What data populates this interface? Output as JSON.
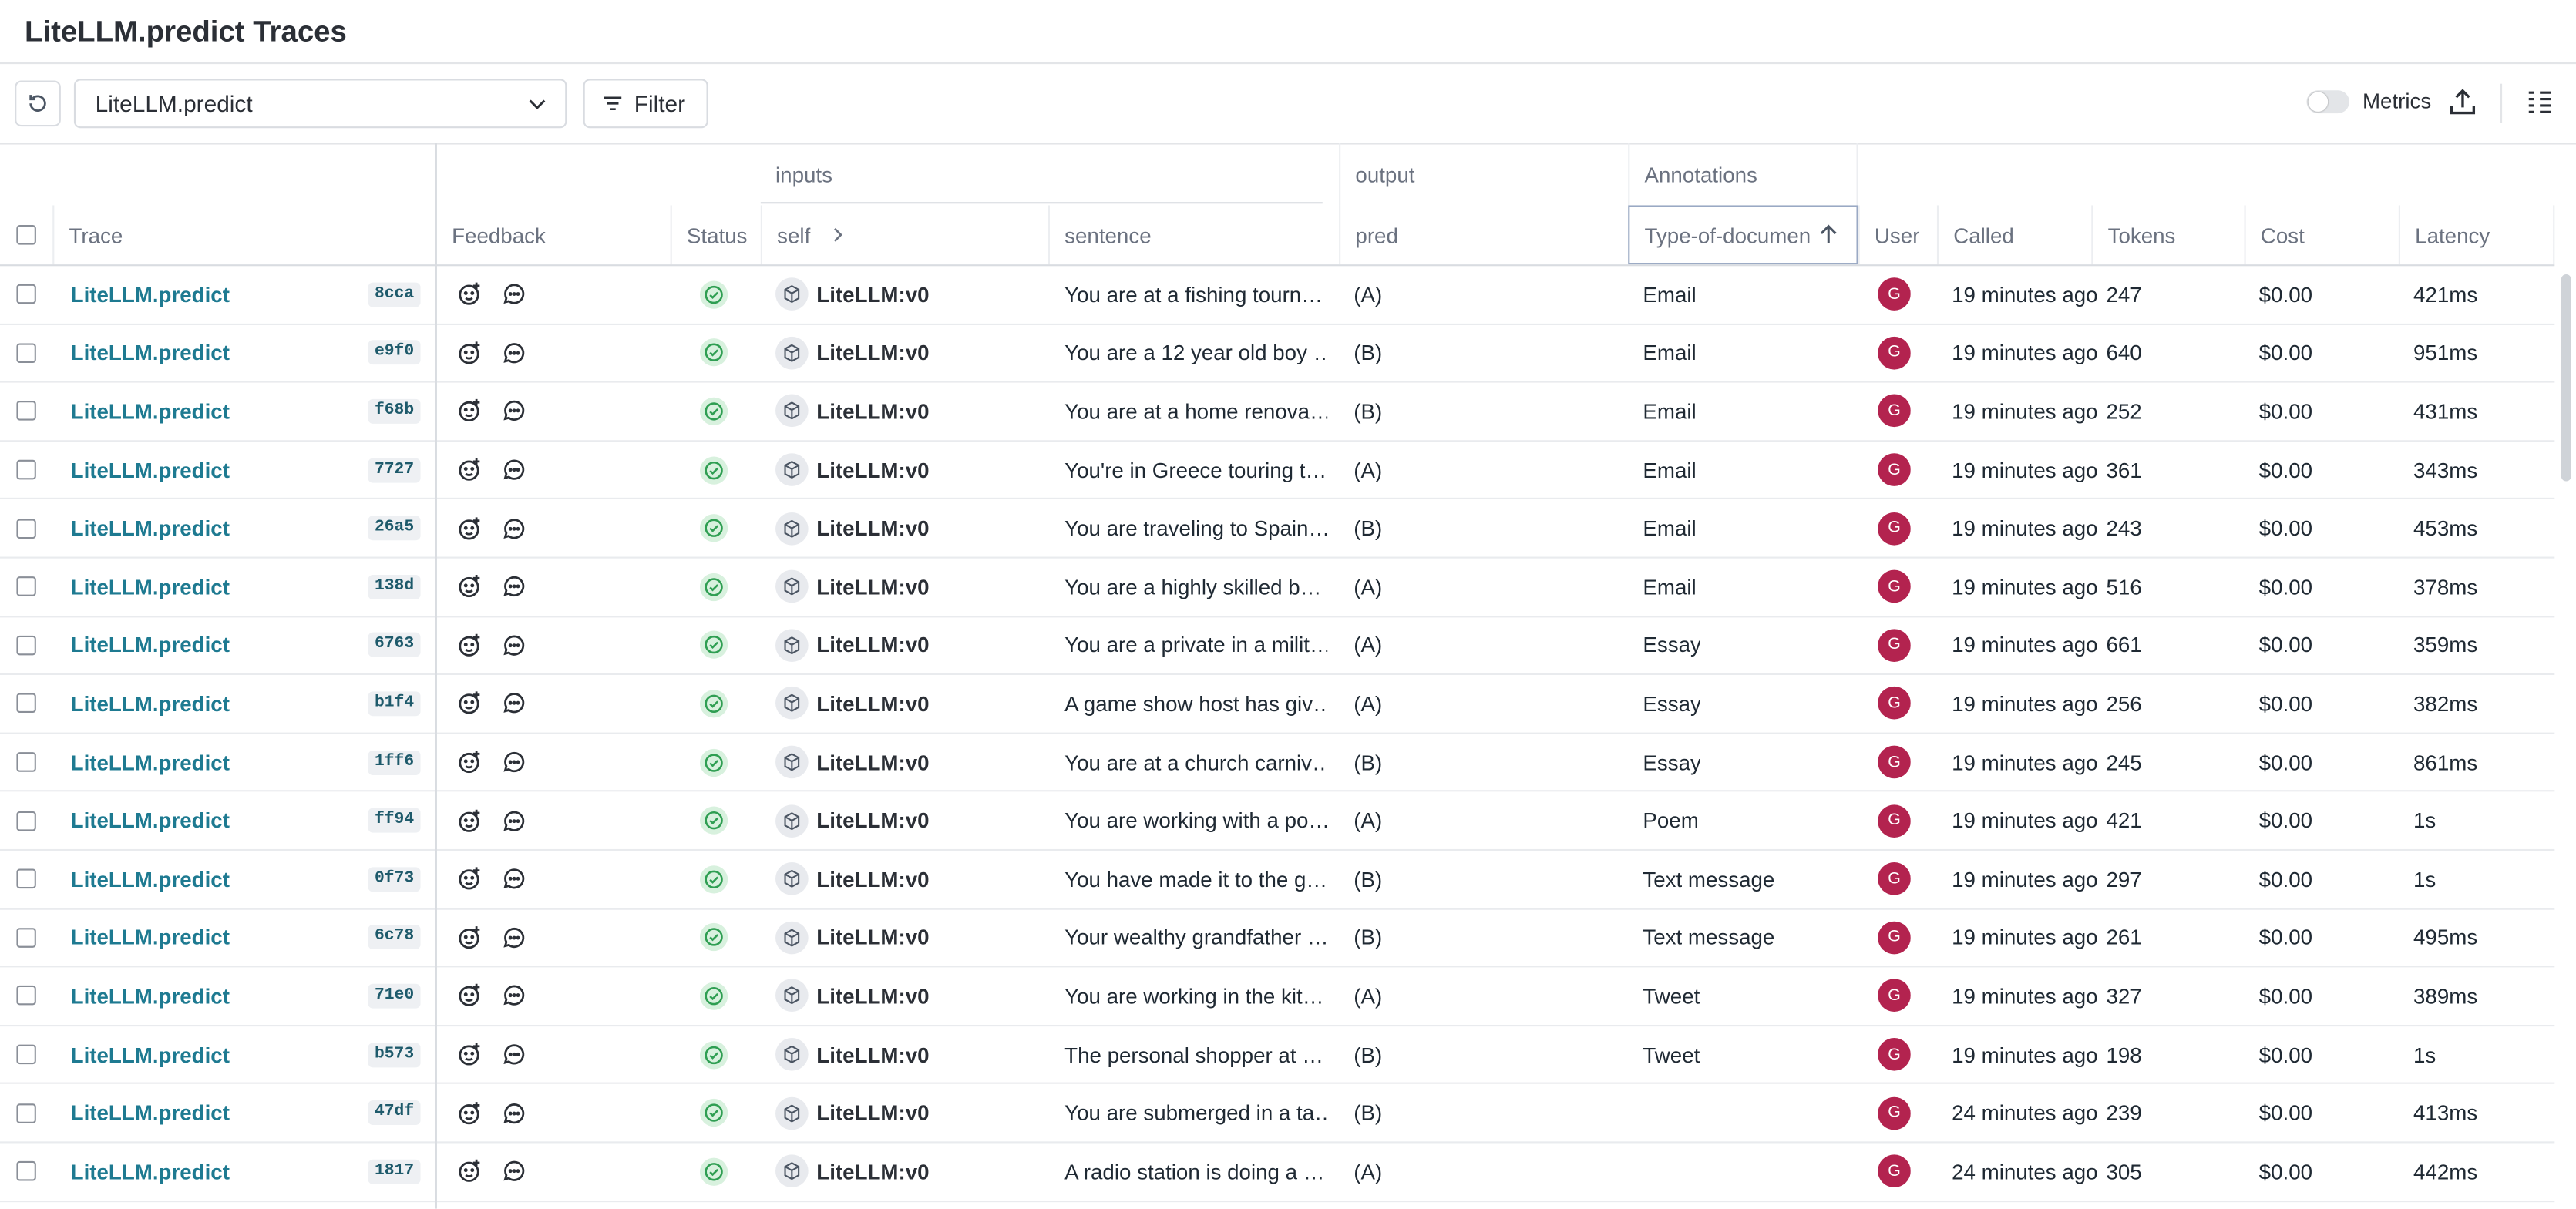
{
  "page_title": "LiteLLM.predict Traces",
  "toolbar": {
    "select_value": "LiteLLM.predict",
    "filter_label": "Filter",
    "metrics_label": "Metrics"
  },
  "groups": {
    "inputs": "inputs",
    "output": "output",
    "annotations": "Annotations"
  },
  "columns": {
    "trace": "Trace",
    "feedback": "Feedback",
    "status": "Status",
    "self": "self",
    "sentence": "sentence",
    "pred": "pred",
    "type_of_document": "Type-of-documen",
    "user": "User",
    "called": "Called",
    "tokens": "Tokens",
    "cost": "Cost",
    "latency": "Latency"
  },
  "rows": [
    {
      "trace": "LiteLLM.predict",
      "hash": "8cca",
      "self": "LiteLLM:v0",
      "sentence": "You are at a fishing tourn…",
      "pred": "(A)",
      "doc_type": "Email",
      "user": "G",
      "called": "19 minutes ago",
      "tokens": "247",
      "cost": "$0.00",
      "latency": "421ms"
    },
    {
      "trace": "LiteLLM.predict",
      "hash": "e9f0",
      "self": "LiteLLM:v0",
      "sentence": "You are a 12 year old boy …",
      "pred": "(B)",
      "doc_type": "Email",
      "user": "G",
      "called": "19 minutes ago",
      "tokens": "640",
      "cost": "$0.00",
      "latency": "951ms"
    },
    {
      "trace": "LiteLLM.predict",
      "hash": "f68b",
      "self": "LiteLLM:v0",
      "sentence": "You are at a home renova…",
      "pred": "(B)",
      "doc_type": "Email",
      "user": "G",
      "called": "19 minutes ago",
      "tokens": "252",
      "cost": "$0.00",
      "latency": "431ms"
    },
    {
      "trace": "LiteLLM.predict",
      "hash": "7727",
      "self": "LiteLLM:v0",
      "sentence": "You're in Greece touring t…",
      "pred": "(A)",
      "doc_type": "Email",
      "user": "G",
      "called": "19 minutes ago",
      "tokens": "361",
      "cost": "$0.00",
      "latency": "343ms"
    },
    {
      "trace": "LiteLLM.predict",
      "hash": "26a5",
      "self": "LiteLLM:v0",
      "sentence": "You are traveling to Spain…",
      "pred": "(B)",
      "doc_type": "Email",
      "user": "G",
      "called": "19 minutes ago",
      "tokens": "243",
      "cost": "$0.00",
      "latency": "453ms"
    },
    {
      "trace": "LiteLLM.predict",
      "hash": "138d",
      "self": "LiteLLM:v0",
      "sentence": "You are a highly skilled b…",
      "pred": "(A)",
      "doc_type": "Email",
      "user": "G",
      "called": "19 minutes ago",
      "tokens": "516",
      "cost": "$0.00",
      "latency": "378ms"
    },
    {
      "trace": "LiteLLM.predict",
      "hash": "6763",
      "self": "LiteLLM:v0",
      "sentence": "You are a private in a milit…",
      "pred": "(A)",
      "doc_type": "Essay",
      "user": "G",
      "called": "19 minutes ago",
      "tokens": "661",
      "cost": "$0.00",
      "latency": "359ms"
    },
    {
      "trace": "LiteLLM.predict",
      "hash": "b1f4",
      "self": "LiteLLM:v0",
      "sentence": "A game show host has giv…",
      "pred": "(A)",
      "doc_type": "Essay",
      "user": "G",
      "called": "19 minutes ago",
      "tokens": "256",
      "cost": "$0.00",
      "latency": "382ms"
    },
    {
      "trace": "LiteLLM.predict",
      "hash": "1ff6",
      "self": "LiteLLM:v0",
      "sentence": "You are at a church carniv…",
      "pred": "(B)",
      "doc_type": "Essay",
      "user": "G",
      "called": "19 minutes ago",
      "tokens": "245",
      "cost": "$0.00",
      "latency": "861ms"
    },
    {
      "trace": "LiteLLM.predict",
      "hash": "ff94",
      "self": "LiteLLM:v0",
      "sentence": "You are working with a po…",
      "pred": "(A)",
      "doc_type": "Poem",
      "user": "G",
      "called": "19 minutes ago",
      "tokens": "421",
      "cost": "$0.00",
      "latency": "1s"
    },
    {
      "trace": "LiteLLM.predict",
      "hash": "0f73",
      "self": "LiteLLM:v0",
      "sentence": "You have made it to the g…",
      "pred": "(B)",
      "doc_type": "Text message",
      "user": "G",
      "called": "19 minutes ago",
      "tokens": "297",
      "cost": "$0.00",
      "latency": "1s"
    },
    {
      "trace": "LiteLLM.predict",
      "hash": "6c78",
      "self": "LiteLLM:v0",
      "sentence": "Your wealthy grandfather …",
      "pred": "(B)",
      "doc_type": "Text message",
      "user": "G",
      "called": "19 minutes ago",
      "tokens": "261",
      "cost": "$0.00",
      "latency": "495ms"
    },
    {
      "trace": "LiteLLM.predict",
      "hash": "71e0",
      "self": "LiteLLM:v0",
      "sentence": "You are working in the kit…",
      "pred": "(A)",
      "doc_type": "Tweet",
      "user": "G",
      "called": "19 minutes ago",
      "tokens": "327",
      "cost": "$0.00",
      "latency": "389ms"
    },
    {
      "trace": "LiteLLM.predict",
      "hash": "b573",
      "self": "LiteLLM:v0",
      "sentence": "The personal shopper at …",
      "pred": "(B)",
      "doc_type": "Tweet",
      "user": "G",
      "called": "19 minutes ago",
      "tokens": "198",
      "cost": "$0.00",
      "latency": "1s"
    },
    {
      "trace": "LiteLLM.predict",
      "hash": "47df",
      "self": "LiteLLM:v0",
      "sentence": "You are submerged in a ta…",
      "pred": "(B)",
      "doc_type": "",
      "user": "G",
      "called": "24 minutes ago",
      "tokens": "239",
      "cost": "$0.00",
      "latency": "413ms"
    },
    {
      "trace": "LiteLLM.predict",
      "hash": "1817",
      "self": "LiteLLM:v0",
      "sentence": "A radio station is doing a …",
      "pred": "(A)",
      "doc_type": "",
      "user": "G",
      "called": "24 minutes ago",
      "tokens": "305",
      "cost": "$0.00",
      "latency": "442ms"
    }
  ]
}
